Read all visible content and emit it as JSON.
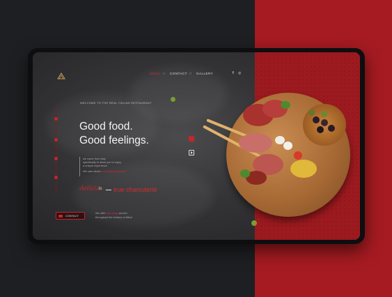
{
  "nav": {
    "items": [
      "MENU",
      "CONTACT",
      "GALLERY"
    ],
    "separator": "//",
    "active_color": "#d62b2b"
  },
  "social": {
    "facebook": "f",
    "instagram": "◎"
  },
  "hero": {
    "welcome": "WELCOME TO THE REAL ITALIAN RESTAURANT",
    "headline_line1": "Good food.",
    "headline_line2": "Good feelings.",
    "desc_line1": "we come from Italy",
    "desc_line2": "specifically to allow you to enjoy",
    "desc_line3": "a unique experience",
    "desc_line4_prefix": "We care about",
    "desc_line4_highlight": "best quality products",
    "brand": "delizia",
    "is_word": "is",
    "tagline": "true charcuterie"
  },
  "contact_button": {
    "label": "CONTACT"
  },
  "offer": {
    "line1_prefix": "We offer",
    "line1_highlight": "take-away",
    "line1_suffix": "service",
    "line2": "throughout the territory of Affuzi"
  },
  "colors": {
    "accent": "#c4262b",
    "dark_bg": "#1e1f22",
    "red_bg": "#a51b21"
  }
}
